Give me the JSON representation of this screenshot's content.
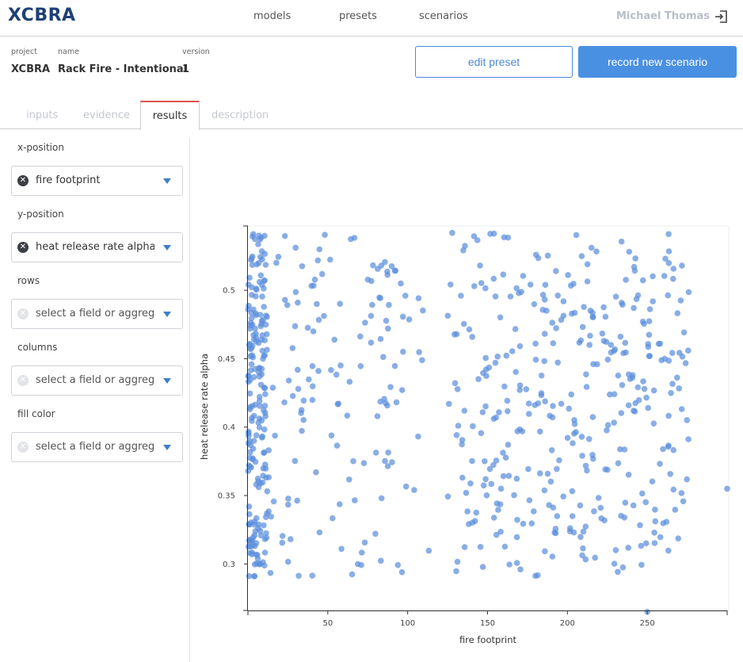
{
  "brand": "XCBRA",
  "nav": {
    "models": "models",
    "presets": "presets",
    "scenarios": "scenarios"
  },
  "user": {
    "name": "Michael Thomas",
    "logout_icon": "logout-icon"
  },
  "project_info": {
    "project_label": "project",
    "project_value": "XCBRA",
    "name_label": "name",
    "name_value": "Rack Fire - Intentional",
    "version_label": "version",
    "version_value": "1"
  },
  "actions": {
    "edit_preset": "edit preset",
    "record_new_scenario": "record new scenario"
  },
  "tabs": {
    "inputs": "inputs",
    "evidence": "evidence",
    "results": "results",
    "description": "description",
    "active": "results"
  },
  "controls": {
    "x_label": "x-position",
    "x_value": "fire footprint",
    "y_label": "y-position",
    "y_value": "heat release rate alpha",
    "rows_label": "rows",
    "rows_placeholder": "select a field or aggregate",
    "columns_label": "columns",
    "columns_placeholder": "select a field or aggregate",
    "fill_label": "fill color",
    "fill_placeholder": "select a field or aggregate"
  },
  "colors": {
    "accent": "#4a90e2",
    "point": "#5b8fdc",
    "active_tab": "#d9534f"
  },
  "chart_data": {
    "type": "scatter",
    "xlabel": "fire footprint",
    "ylabel": "heat release rate alpha",
    "xlim": [
      0,
      300
    ],
    "ylim": [
      0.266,
      0.547
    ],
    "x_ticks": [
      50,
      100,
      150,
      200,
      250
    ],
    "y_ticks": [
      0.3,
      0.35,
      0.4,
      0.45,
      0.5
    ],
    "grid": false,
    "n_points": 700,
    "cluster_1_x_range": [
      0,
      115
    ],
    "cluster_2_x_range": [
      125,
      276
    ],
    "outliers": [
      {
        "x": 300,
        "y": 0.355
      },
      {
        "x": 250,
        "y": 0.265
      }
    ]
  }
}
